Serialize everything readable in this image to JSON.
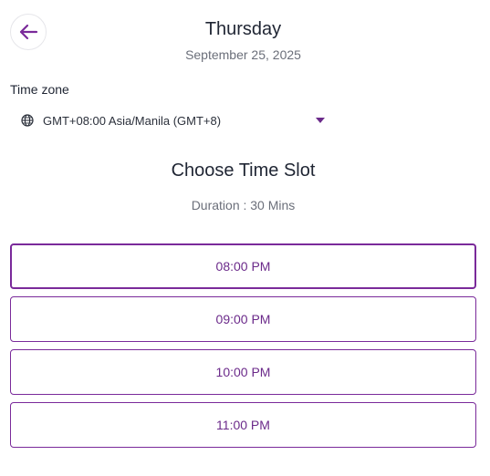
{
  "header": {
    "day": "Thursday",
    "date": "September 25, 2025",
    "back_icon": "arrow-left-icon"
  },
  "timezone": {
    "label": "Time zone",
    "value": "GMT+08:00 Asia/Manila (GMT+8)",
    "icon": "globe-icon"
  },
  "schedule": {
    "title": "Choose Time Slot",
    "duration": "Duration : 30 Mins",
    "slots": [
      "08:00 PM",
      "09:00 PM",
      "10:00 PM",
      "11:00 PM"
    ]
  },
  "colors": {
    "accent": "#6b2a8a",
    "border": "#7a2a9a"
  }
}
